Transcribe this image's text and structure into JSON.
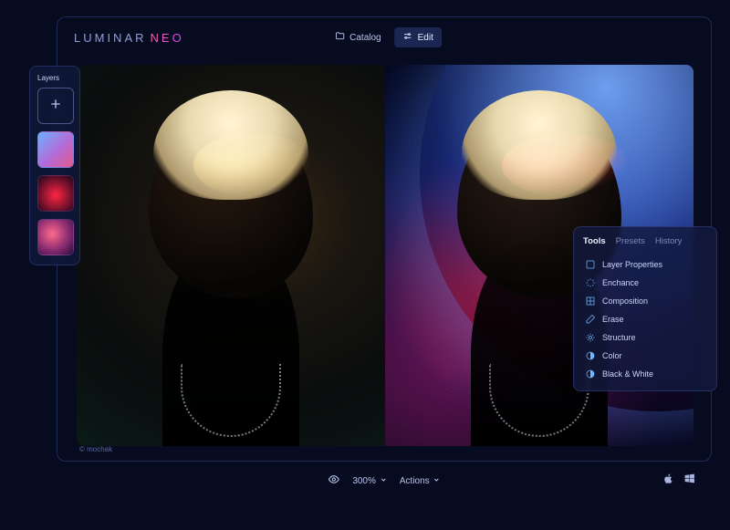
{
  "brand": {
    "part_a": "LUMINAR",
    "part_b": "NEO"
  },
  "top_tabs": {
    "catalog": "Catalog",
    "edit": "Edit"
  },
  "layers": {
    "title": "Layers"
  },
  "tools_panel": {
    "tabs": {
      "tools": "Tools",
      "presets": "Presets",
      "history": "History"
    },
    "items": [
      {
        "label": "Layer Properties",
        "icon": "layer-properties"
      },
      {
        "label": "Enchance",
        "icon": "enhance"
      },
      {
        "label": "Composition",
        "icon": "composition"
      },
      {
        "label": "Erase",
        "icon": "erase"
      },
      {
        "label": "Structure",
        "icon": "structure"
      },
      {
        "label": "Color",
        "icon": "color"
      },
      {
        "label": "Black & White",
        "icon": "black-white"
      }
    ]
  },
  "credit": "© mochak",
  "footer": {
    "zoom": "300%",
    "actions": "Actions"
  }
}
